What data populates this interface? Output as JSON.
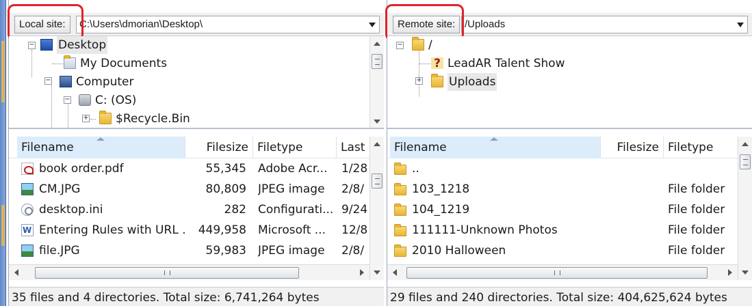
{
  "local": {
    "site_label": "Local site:",
    "path": "C:\\Users\\dmorian\\Desktop\\",
    "tree": [
      {
        "label": "Desktop",
        "icon": "desktop-icon"
      },
      {
        "label": "My Documents",
        "icon": "documents-folder-icon"
      },
      {
        "label": "Computer",
        "icon": "computer-icon"
      },
      {
        "label": "C: (OS)",
        "icon": "drive-icon"
      },
      {
        "label": "$Recycle.Bin",
        "icon": "folder-icon"
      }
    ],
    "columns": [
      "Filename",
      "Filesize",
      "Filetype",
      "Last"
    ],
    "files": [
      {
        "name": "book order.pdf",
        "size": "55,345",
        "type": "Adobe Acr...",
        "date": "1/28",
        "icon": "pdf-icon"
      },
      {
        "name": "CM.JPG",
        "size": "80,809",
        "type": "JPEG image",
        "date": "2/8/",
        "icon": "jpeg-icon"
      },
      {
        "name": "desktop.ini",
        "size": "282",
        "type": "Configurati...",
        "date": "9/24",
        "icon": "config-file-icon"
      },
      {
        "name": "Entering Rules with URL ...",
        "size": "449,958",
        "type": "Microsoft ...",
        "date": "12/8",
        "icon": "word-doc-icon"
      },
      {
        "name": "file.JPG",
        "size": "59,983",
        "type": "JPEG image",
        "date": "2/8/",
        "icon": "jpeg-icon"
      }
    ],
    "status": "35 files and 4 directories. Total size: 6,741,264 bytes"
  },
  "remote": {
    "site_label": "Remote site:",
    "path": "/Uploads",
    "tree": [
      {
        "label": "/",
        "icon": "folder-icon"
      },
      {
        "label": "LeadAR Talent Show",
        "icon": "unknown-folder-icon"
      },
      {
        "label": "Uploads",
        "icon": "folder-icon"
      }
    ],
    "columns": [
      "Filename",
      "Filesize",
      "Filetype"
    ],
    "files": [
      {
        "name": "..",
        "size": "",
        "type": "",
        "icon": "folder-icon"
      },
      {
        "name": "103_1218",
        "size": "",
        "type": "File folder",
        "icon": "folder-icon"
      },
      {
        "name": "104_1219",
        "size": "",
        "type": "File folder",
        "icon": "folder-icon"
      },
      {
        "name": "111111-Unknown Photos",
        "size": "",
        "type": "File folder",
        "icon": "folder-icon"
      },
      {
        "name": "2010 Halloween",
        "size": "",
        "type": "File folder",
        "icon": "folder-icon"
      }
    ],
    "status": "29 files and 240 directories. Total size: 404,625,624 bytes"
  },
  "colors": {
    "highlight": "#e0222a",
    "sorted_header": "#dcecfb"
  },
  "scroll_icons": {
    "up": "scroll-up-arrow-icon",
    "down": "scroll-down-arrow-icon",
    "left": "scroll-left-arrow-icon",
    "right": "scroll-right-arrow-icon"
  }
}
